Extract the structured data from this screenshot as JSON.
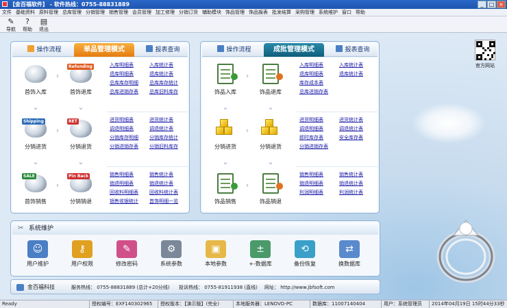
{
  "window": {
    "title": "【金百福软件】 - 软件热线：0755-88831889",
    "btn_min": "_",
    "btn_max": "□",
    "btn_close": "×"
  },
  "menu": [
    "文件",
    "基础资料",
    "原料管理",
    "总库管理",
    "分销管理",
    "销售管理",
    "会员管理",
    "加工修理",
    "分销订货",
    "辅助模块",
    "饰品管理",
    "饰品报表",
    "批发结算",
    "采购管理",
    "系统维护",
    "窗口",
    "帮助"
  ],
  "toolbar": [
    {
      "label": "导航",
      "icon": "navigate-icon",
      "glyph": "✎"
    },
    {
      "label": "帮助",
      "icon": "help-icon",
      "glyph": "?"
    },
    {
      "label": "退出",
      "icon": "exit-icon",
      "glyph": "▤"
    }
  ],
  "left_panel": {
    "tabs": [
      {
        "label": "操作流程",
        "icon": "flow-icon"
      },
      {
        "label": "单品管理模式",
        "icon": ""
      },
      {
        "label": "报表查询",
        "icon": "report-icon"
      }
    ],
    "flow": [
      {
        "label": "首饰入库",
        "badge": ""
      },
      {
        "label": "首饰退库",
        "badge": "Refunding"
      },
      {
        "label": "分销进货",
        "badge": "Shipping"
      },
      {
        "label": "分销退货",
        "badge": "RET"
      },
      {
        "label": "首饰销售",
        "badge": "SALE"
      },
      {
        "label": "分销销退",
        "badge": "Pin Back"
      }
    ],
    "links": [
      [
        "入库明细表",
        "入库统计表"
      ],
      [
        "退库明细表",
        "退库统计表"
      ],
      [
        "总库库存明细",
        "总库库存统计"
      ],
      [
        "总库进销存表",
        "总库旧料库存"
      ],
      [
        "进货明细表",
        "进货统计表"
      ],
      [
        "调退明细表",
        "调退统计表"
      ],
      [
        "分销库存明细",
        "分销库存统计"
      ],
      [
        "分销进销存表",
        "分销旧料库存"
      ],
      [
        "销售明细表",
        "销售统计表"
      ],
      [
        "销退明细表",
        "销退统计表"
      ],
      [
        "回收料明细表",
        "回收料统计表"
      ],
      [
        "销售收银统计",
        "首饰明细一览"
      ]
    ]
  },
  "right_panel": {
    "tabs": [
      {
        "label": "操作流程",
        "icon": "flow-icon"
      },
      {
        "label": "成批管理模式",
        "icon": ""
      },
      {
        "label": "报表查询",
        "icon": "report-icon"
      }
    ],
    "flow": [
      {
        "label": "饰品入库"
      },
      {
        "label": "饰品退库"
      },
      {
        "label": "分销进货"
      },
      {
        "label": "分销退货"
      },
      {
        "label": "饰品销售"
      },
      {
        "label": "饰品销退"
      }
    ],
    "links": [
      [
        "入库明细表",
        "入库统计表"
      ],
      [
        "退库明细表",
        "退库统计表"
      ],
      [
        "库存成本表",
        ""
      ],
      [
        "总库进销存表",
        ""
      ],
      [
        "进货明细表",
        "进货统计表"
      ],
      [
        "调退明细表",
        "调退统计表"
      ],
      [
        "即时库存表",
        "安全库存表"
      ],
      [
        "分销进销存表",
        ""
      ],
      [
        "销售明细表",
        "销售统计表"
      ],
      [
        "销退明细表",
        "销退统计表"
      ],
      [
        "利润明细表",
        "利润统计表"
      ]
    ]
  },
  "qr_caption": "官方网站",
  "system": {
    "title": "系统维护",
    "buttons": [
      {
        "label": "用户维护",
        "icon": "user-icon",
        "color": "#4a7fc4"
      },
      {
        "label": "用户权限",
        "icon": "key-icon",
        "color": "#e0a020"
      },
      {
        "label": "修改密码",
        "icon": "password-icon",
        "color": "#d0508a"
      },
      {
        "label": "系统参数",
        "icon": "gear-icon",
        "color": "#7a8899"
      },
      {
        "label": "本地参数",
        "icon": "folder-icon",
        "color": "#e6b848"
      },
      {
        "label": "+-数据库",
        "icon": "database-icon",
        "color": "#4a9a6a"
      },
      {
        "label": "备份恢复",
        "icon": "backup-icon",
        "color": "#3aa0c8"
      },
      {
        "label": "换数据库",
        "icon": "switch-db-icon",
        "color": "#5a8acc"
      }
    ]
  },
  "info": {
    "company": "金百福科技",
    "service": "服务热线： 0755-88831889 (总计+20分线)",
    "complaint": "投诉热线： 0755-81911938 (直线)",
    "website": "网址： http://www.jbfsoft.com"
  },
  "status": [
    "Ready",
    "授权编号：EXF140302965",
    "授权版本：【演示版】(完全)",
    "本地服务器：LENOVO-PC",
    "数据库：11007140404",
    "用户：系统管理员",
    "2014年04月19日 15时44分33秒"
  ]
}
